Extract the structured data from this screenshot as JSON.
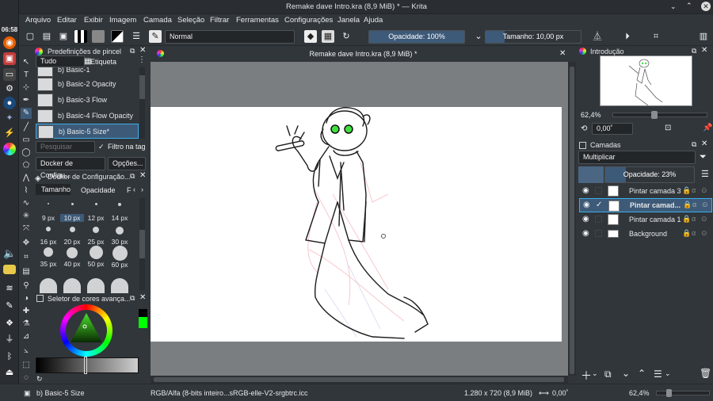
{
  "window": {
    "title": "Remake dave Intro.kra (8,9 MiB) * — Krita"
  },
  "menu": [
    "Arquivo",
    "Editar",
    "Exibir",
    "Imagem",
    "Camada",
    "Seleção",
    "Filtrar",
    "Ferramentas",
    "Configurações",
    "Janela",
    "Ajuda"
  ],
  "clock": "06:58",
  "toolbar": {
    "blend_mode": "Normal",
    "opacity": "Opacidade: 100%",
    "opacity_value": 1.0,
    "size": "Tamanho: 10,00 px"
  },
  "brush_presets": {
    "title": "Predefinições de pincel",
    "filter": "Tudo",
    "tag_label": "Etiqueta",
    "items": [
      "b) Basic-1",
      "b) Basic-2 Opacity",
      "b) Basic-3 Flow",
      "b) Basic-4 Flow Opacity",
      "b) Basic-5 Size*"
    ],
    "search_placeholder": "Pesquisar",
    "filter_tag": "Filtro na tag"
  },
  "config_tabs": [
    "Docker de Configu...",
    "Opções..."
  ],
  "config_docker": {
    "title": "Docker de Configuração...",
    "tabs": [
      "Tamanho",
      "Opacidade",
      "F"
    ],
    "sizes": [
      "9 px",
      "10 px",
      "12 px",
      "14 px",
      "16 px",
      "20 px",
      "25 px",
      "30 px",
      "35 px",
      "40 px",
      "50 px",
      "60 px"
    ]
  },
  "color_selector": {
    "title": "Seletor de cores avança..."
  },
  "view_tab": "Remake dave Intro.kra (8,9 MiB) *",
  "overview": {
    "title": "Introdução",
    "zoom": "62,4%",
    "rotation": "0,00˚"
  },
  "layers": {
    "title": "Camadas",
    "blend": "Multiplicar",
    "opacity": "Opacidade:  23%",
    "opacity_value": 0.23,
    "items": [
      "Pintar camada 3",
      "Pintar camad...",
      "Pintar camada 1",
      "Background"
    ]
  },
  "status": {
    "brush": "b) Basic-5 Size",
    "colorspace": "RGB/Alfa (8-bits inteiro...sRGB-elle-V2-srgbtrc.icc",
    "dimensions": "1.280 x 720 (8,9 MiB)",
    "rotation": "0,00˚",
    "zoom": "62,4%"
  },
  "colors": {
    "accent": "#3daee9",
    "panel": "#31363b",
    "slider": "#3d5a78"
  }
}
